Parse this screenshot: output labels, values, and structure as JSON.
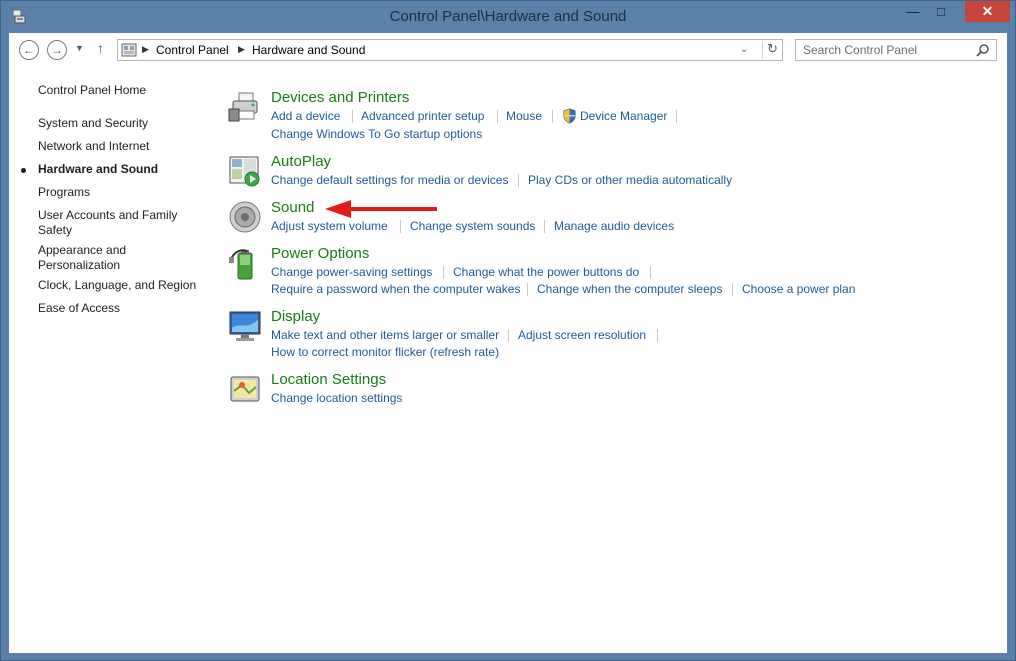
{
  "window": {
    "title": "Control Panel\\Hardware and Sound"
  },
  "nav": {
    "breadcrumbs": [
      "Control Panel",
      "Hardware and Sound"
    ],
    "search_placeholder": "Search Control Panel"
  },
  "sidebar": {
    "home": "Control Panel Home",
    "items": [
      "System and Security",
      "Network and Internet",
      "Hardware and Sound",
      "Programs",
      "User Accounts and Family Safety",
      "Appearance and Personalization",
      "Clock, Language, and Region",
      "Ease of Access"
    ],
    "active_index": 2
  },
  "categories": {
    "devices": {
      "title": "Devices and Printers",
      "links": [
        "Add a device",
        "Advanced printer setup",
        "Mouse",
        "Device Manager",
        "Change Windows To Go startup options"
      ]
    },
    "autoplay": {
      "title": "AutoPlay",
      "links": [
        "Change default settings for media or devices",
        "Play CDs or other media automatically"
      ]
    },
    "sound": {
      "title": "Sound",
      "links": [
        "Adjust system volume",
        "Change system sounds",
        "Manage audio devices"
      ]
    },
    "power": {
      "title": "Power Options",
      "links": [
        "Change power-saving settings",
        "Change what the power buttons do",
        "Require a password when the computer wakes",
        "Change when the computer sleeps",
        "Choose a power plan"
      ]
    },
    "display": {
      "title": "Display",
      "links": [
        "Make text and other items larger or smaller",
        "Adjust screen resolution",
        "How to correct monitor flicker (refresh rate)"
      ]
    },
    "location": {
      "title": "Location Settings",
      "links": [
        "Change location settings"
      ]
    }
  },
  "colors": {
    "title_green": "#1a7a14",
    "link_blue": "#1e5a96",
    "chrome": "#5b80aa",
    "close_red": "#c7443a",
    "annotation_arrow": "#e31b1b"
  }
}
